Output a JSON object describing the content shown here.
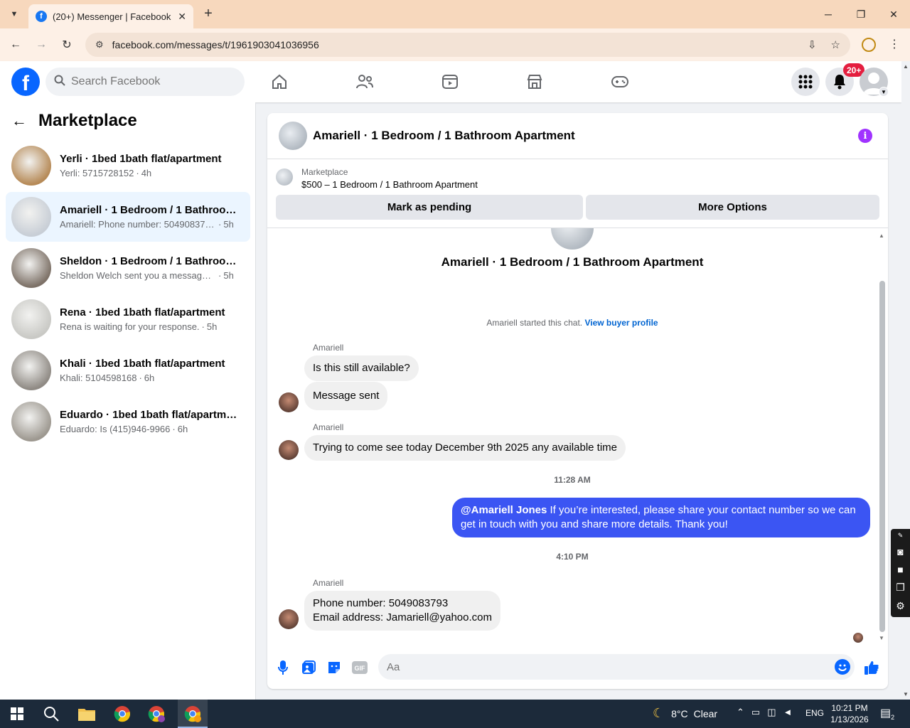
{
  "browser": {
    "tab_title": "(20+) Messenger | Facebook",
    "tab_close": "✕",
    "new_tab": "+",
    "url": "facebook.com/messages/t/1961903041036956",
    "controls": {
      "minimize": "─",
      "restore": "❐",
      "close": "✕"
    }
  },
  "fb": {
    "search_placeholder": "Search Facebook",
    "notifications_badge": "20+",
    "logo_letter": "f"
  },
  "sidebar": {
    "title": "Marketplace",
    "conversations": [
      {
        "name": "Yerli · 1bed 1bath flat/apartment",
        "preview": "Yerli: 5715728152",
        "time": "4h",
        "active": false,
        "thumb_color": "#b68a57"
      },
      {
        "name": "Amariell · 1 Bedroom / 1 Bathroom…",
        "preview": "Amariell: Phone number: 5049083793 …",
        "time": "5h",
        "active": true,
        "thumb_color": "#c8ced6"
      },
      {
        "name": "Sheldon · 1 Bedroom / 1 Bathroom…",
        "preview": "Sheldon Welch sent you a message a…",
        "time": "5h",
        "active": false,
        "thumb_color": "#7d7167"
      },
      {
        "name": "Rena · 1bed 1bath flat/apartment",
        "preview": "Rena is waiting for your response.",
        "time": "5h",
        "active": false,
        "thumb_color": "#c9c9c5"
      },
      {
        "name": "Khali · 1bed 1bath flat/apartment",
        "preview": "Khali: 5104598168",
        "time": "6h",
        "active": false,
        "thumb_color": "#8f8a84"
      },
      {
        "name": "Eduardo · 1bed 1bath flat/apartment",
        "preview": "Eduardo: Is (415)946-9966",
        "time": "6h",
        "active": false,
        "thumb_color": "#9d9890"
      }
    ]
  },
  "chat": {
    "header_title": "Amariell · 1 Bedroom / 1 Bathroom Apartment",
    "marketplace_label": "Marketplace",
    "listing": "$500 – 1 Bedroom / 1 Bathroom Apartment",
    "mark_pending": "Mark as pending",
    "more_options": "More Options",
    "intro_title": "Amariell · 1 Bedroom / 1 Bathroom Apartment",
    "started_text": "Amariell started this chat.",
    "view_profile": "View buyer profile",
    "messages": {
      "sender1": "Amariell",
      "m1": "Is this still available?",
      "m2": "Message sent",
      "sender2": "Amariell",
      "m3": "Trying to come see today December 9th 2025 any available time",
      "ts1": "11:28 AM",
      "out_mention": "@Amariell Jones",
      "out_text": " If you’re interested, please share your contact number so we can get in touch with you and share more details. Thank you!",
      "ts2": "4:10 PM",
      "sender3": "Amariell",
      "m4_line1": "Phone number:  5049083793",
      "m4_line2": "Email address: Jamariell@yahoo.com"
    },
    "input_placeholder": "Aa"
  },
  "taskbar": {
    "weather_temp": "8°C",
    "weather_desc": "Clear",
    "lang": "ENG",
    "time": "10:21 PM",
    "date": "1/13/2026",
    "notif_count": "2"
  },
  "colors": {
    "fb_blue": "#0866ff",
    "outgoing_bubble": "#3b55f3",
    "info_purple": "#a033ff",
    "badge_red": "#e41e3f"
  }
}
